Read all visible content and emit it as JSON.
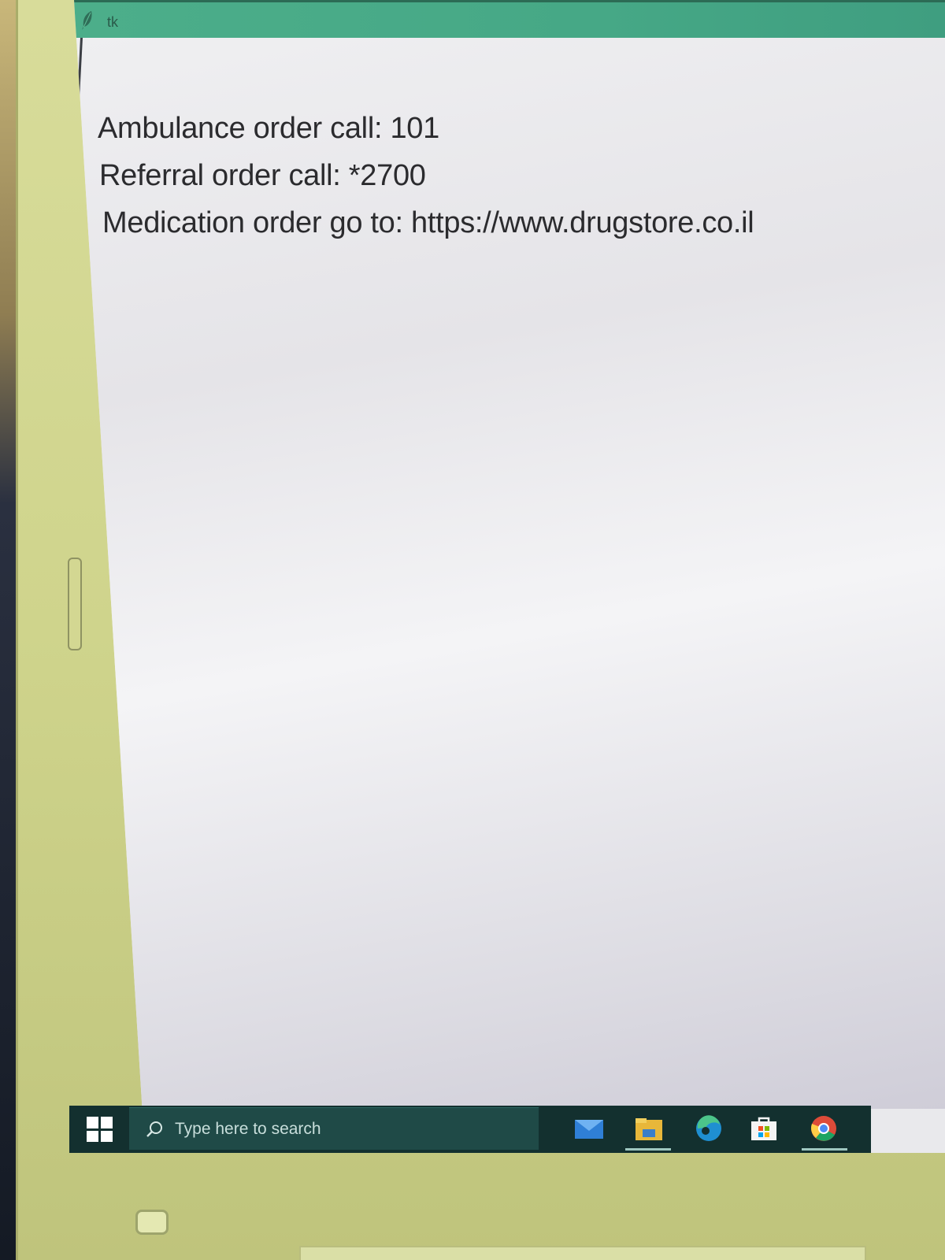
{
  "window": {
    "title": "tk"
  },
  "content": {
    "lines": [
      "Ambulance order call:  101",
      "Referral order call: *2700",
      "Medication order go to: https://www.drugstore.co.il"
    ]
  },
  "taskbar": {
    "search_placeholder": "Type here to search",
    "apps": [
      {
        "icon": "mail-icon",
        "running": false
      },
      {
        "icon": "file-explorer-icon",
        "running": true
      },
      {
        "icon": "edge-icon",
        "running": false
      },
      {
        "icon": "store-icon",
        "running": false
      },
      {
        "icon": "chrome-icon",
        "running": true
      }
    ]
  },
  "colors": {
    "titlebar": "#4cae8a",
    "taskbar": "#13302f",
    "searchbox": "#1f4a47",
    "text": "#2b2b2e"
  }
}
